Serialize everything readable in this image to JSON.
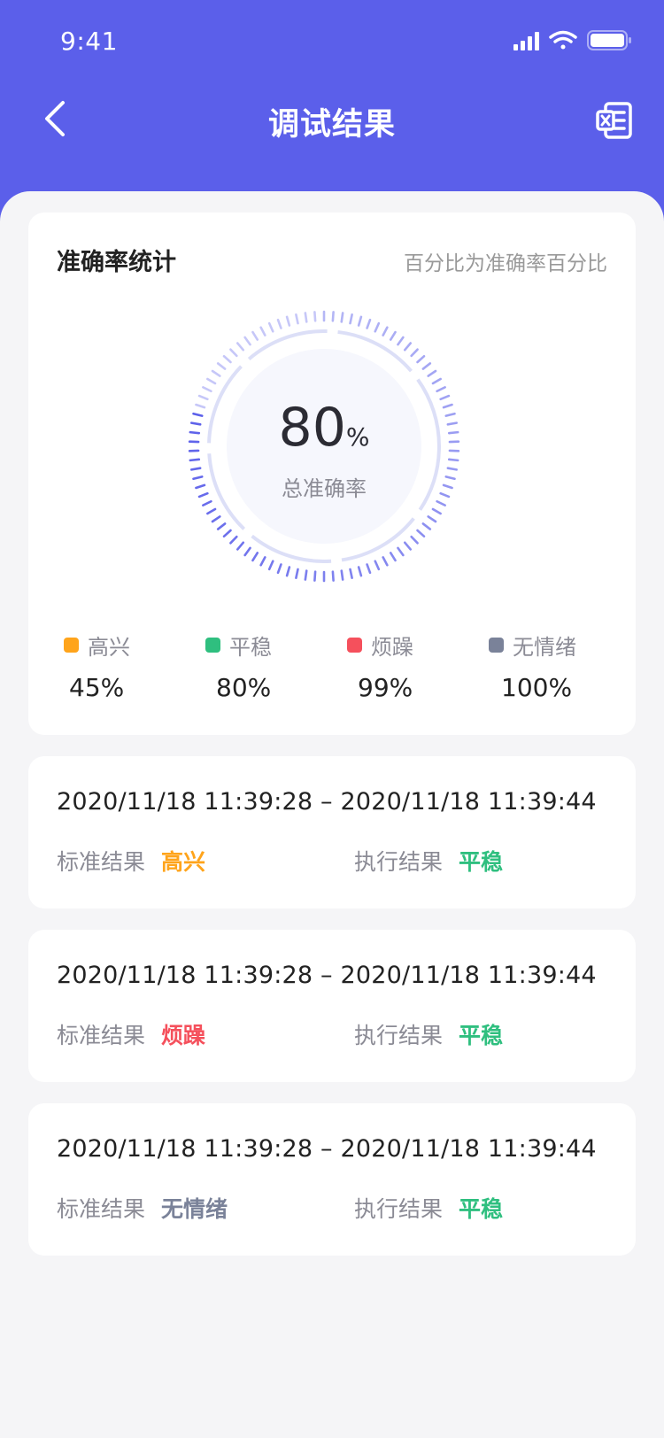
{
  "status_bar": {
    "time": "9:41"
  },
  "nav": {
    "title": "调试结果",
    "back_icon": "chevron-left-icon",
    "export_icon": "excel-export-icon"
  },
  "stats": {
    "title": "准确率统计",
    "note": "百分比为准确率百分比",
    "total_value": "80",
    "total_unit": "%",
    "total_label": "总准确率",
    "total_fraction": 0.8,
    "legend": [
      {
        "label": "高兴",
        "value": "45%",
        "color": "#ffa41b"
      },
      {
        "label": "平稳",
        "value": "80%",
        "color": "#2fbf7f"
      },
      {
        "label": "烦躁",
        "value": "99%",
        "color": "#f5505c"
      },
      {
        "label": "无情绪",
        "value": "100%",
        "color": "#7a8299"
      }
    ]
  },
  "records": [
    {
      "time": "2020/11/18 11:39:28 – 2020/11/18 11:39:44",
      "std_label": "标准结果",
      "std_value": "高兴",
      "std_color": "#ffa41b",
      "exec_label": "执行结果",
      "exec_value": "平稳",
      "exec_color": "#2fbf7f"
    },
    {
      "time": "2020/11/18 11:39:28 – 2020/11/18 11:39:44",
      "std_label": "标准结果",
      "std_value": "烦躁",
      "std_color": "#f5505c",
      "exec_label": "执行结果",
      "exec_value": "平稳",
      "exec_color": "#2fbf7f"
    },
    {
      "time": "2020/11/18 11:39:28 – 2020/11/18 11:39:44",
      "std_label": "标准结果",
      "std_value": "无情绪",
      "std_color": "#7a8299",
      "exec_label": "执行结果",
      "exec_value": "平稳",
      "exec_color": "#2fbf7f"
    }
  ],
  "colors": {
    "accent": "#5b5fea"
  }
}
